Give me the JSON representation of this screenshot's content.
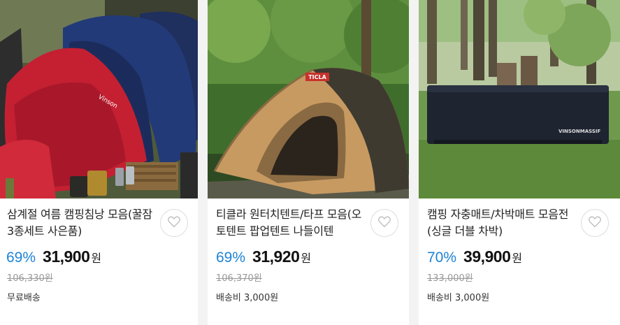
{
  "products": [
    {
      "title": "삼계절 여름 캠핑침낭 모음(꿀잠3종세트 사은품)",
      "discount": "69%",
      "price": "31,900",
      "currency": "원",
      "original_price": "106,330원",
      "shipping": "무료배송",
      "image": "sleeping-bag-photo",
      "wishlist_icon": "heart-icon"
    },
    {
      "title": "티클라 원터치텐트/타프 모음(오토텐트 팝업텐트 나들이텐",
      "discount": "69%",
      "price": "31,920",
      "currency": "원",
      "original_price": "106,370원",
      "shipping": "배송비 3,000원",
      "image": "tent-photo",
      "wishlist_icon": "heart-icon"
    },
    {
      "title": "캠핑 자충매트/차박매트 모음전(싱글 더블 차박)",
      "discount": "70%",
      "price": "39,900",
      "currency": "원",
      "original_price": "133,000원",
      "shipping": "배송비 3,000원",
      "image": "camping-mat-photo",
      "wishlist_icon": "heart-icon"
    }
  ],
  "image_logos": {
    "tent": "TICLA",
    "mat": "VINSONMASSIF",
    "sleeping_bag": "Vinson"
  },
  "colors": {
    "discount": "#1e83d6",
    "price": "#111111",
    "original_price": "#999999"
  }
}
